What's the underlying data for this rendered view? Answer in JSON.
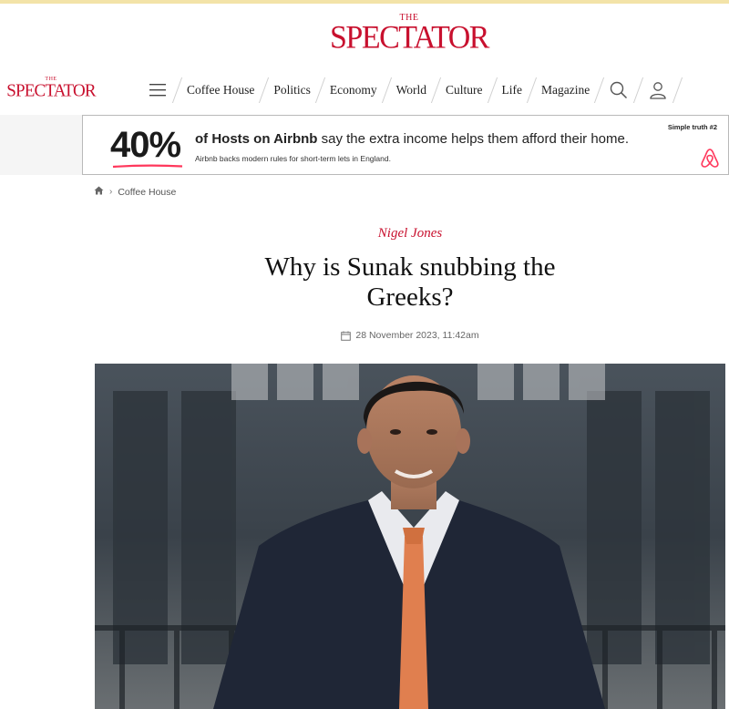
{
  "brand": {
    "the": "THE",
    "name": "SPECTATOR",
    "color": "#c8102e"
  },
  "nav": {
    "items": [
      "Coffee House",
      "Politics",
      "Economy",
      "World",
      "Culture",
      "Life",
      "Magazine"
    ],
    "icons": [
      "menu-icon",
      "search-icon",
      "user-icon"
    ]
  },
  "ad": {
    "percent": "40%",
    "headline_bold": "of Hosts on Airbnb",
    "headline_rest": " say the extra income helps them afford their home.",
    "sub": "Airbnb backs modern rules for short-term lets in England.",
    "tag": "Simple truth #2",
    "brand_icon": "airbnb-icon",
    "accent": "#ff385c"
  },
  "breadcrumb": {
    "icon": "home-icon",
    "section": "Coffee House"
  },
  "article": {
    "author": "Nigel Jones",
    "title": "Why is Sunak snubbing the Greeks?",
    "date": "28 November 2023, 11:42am"
  }
}
